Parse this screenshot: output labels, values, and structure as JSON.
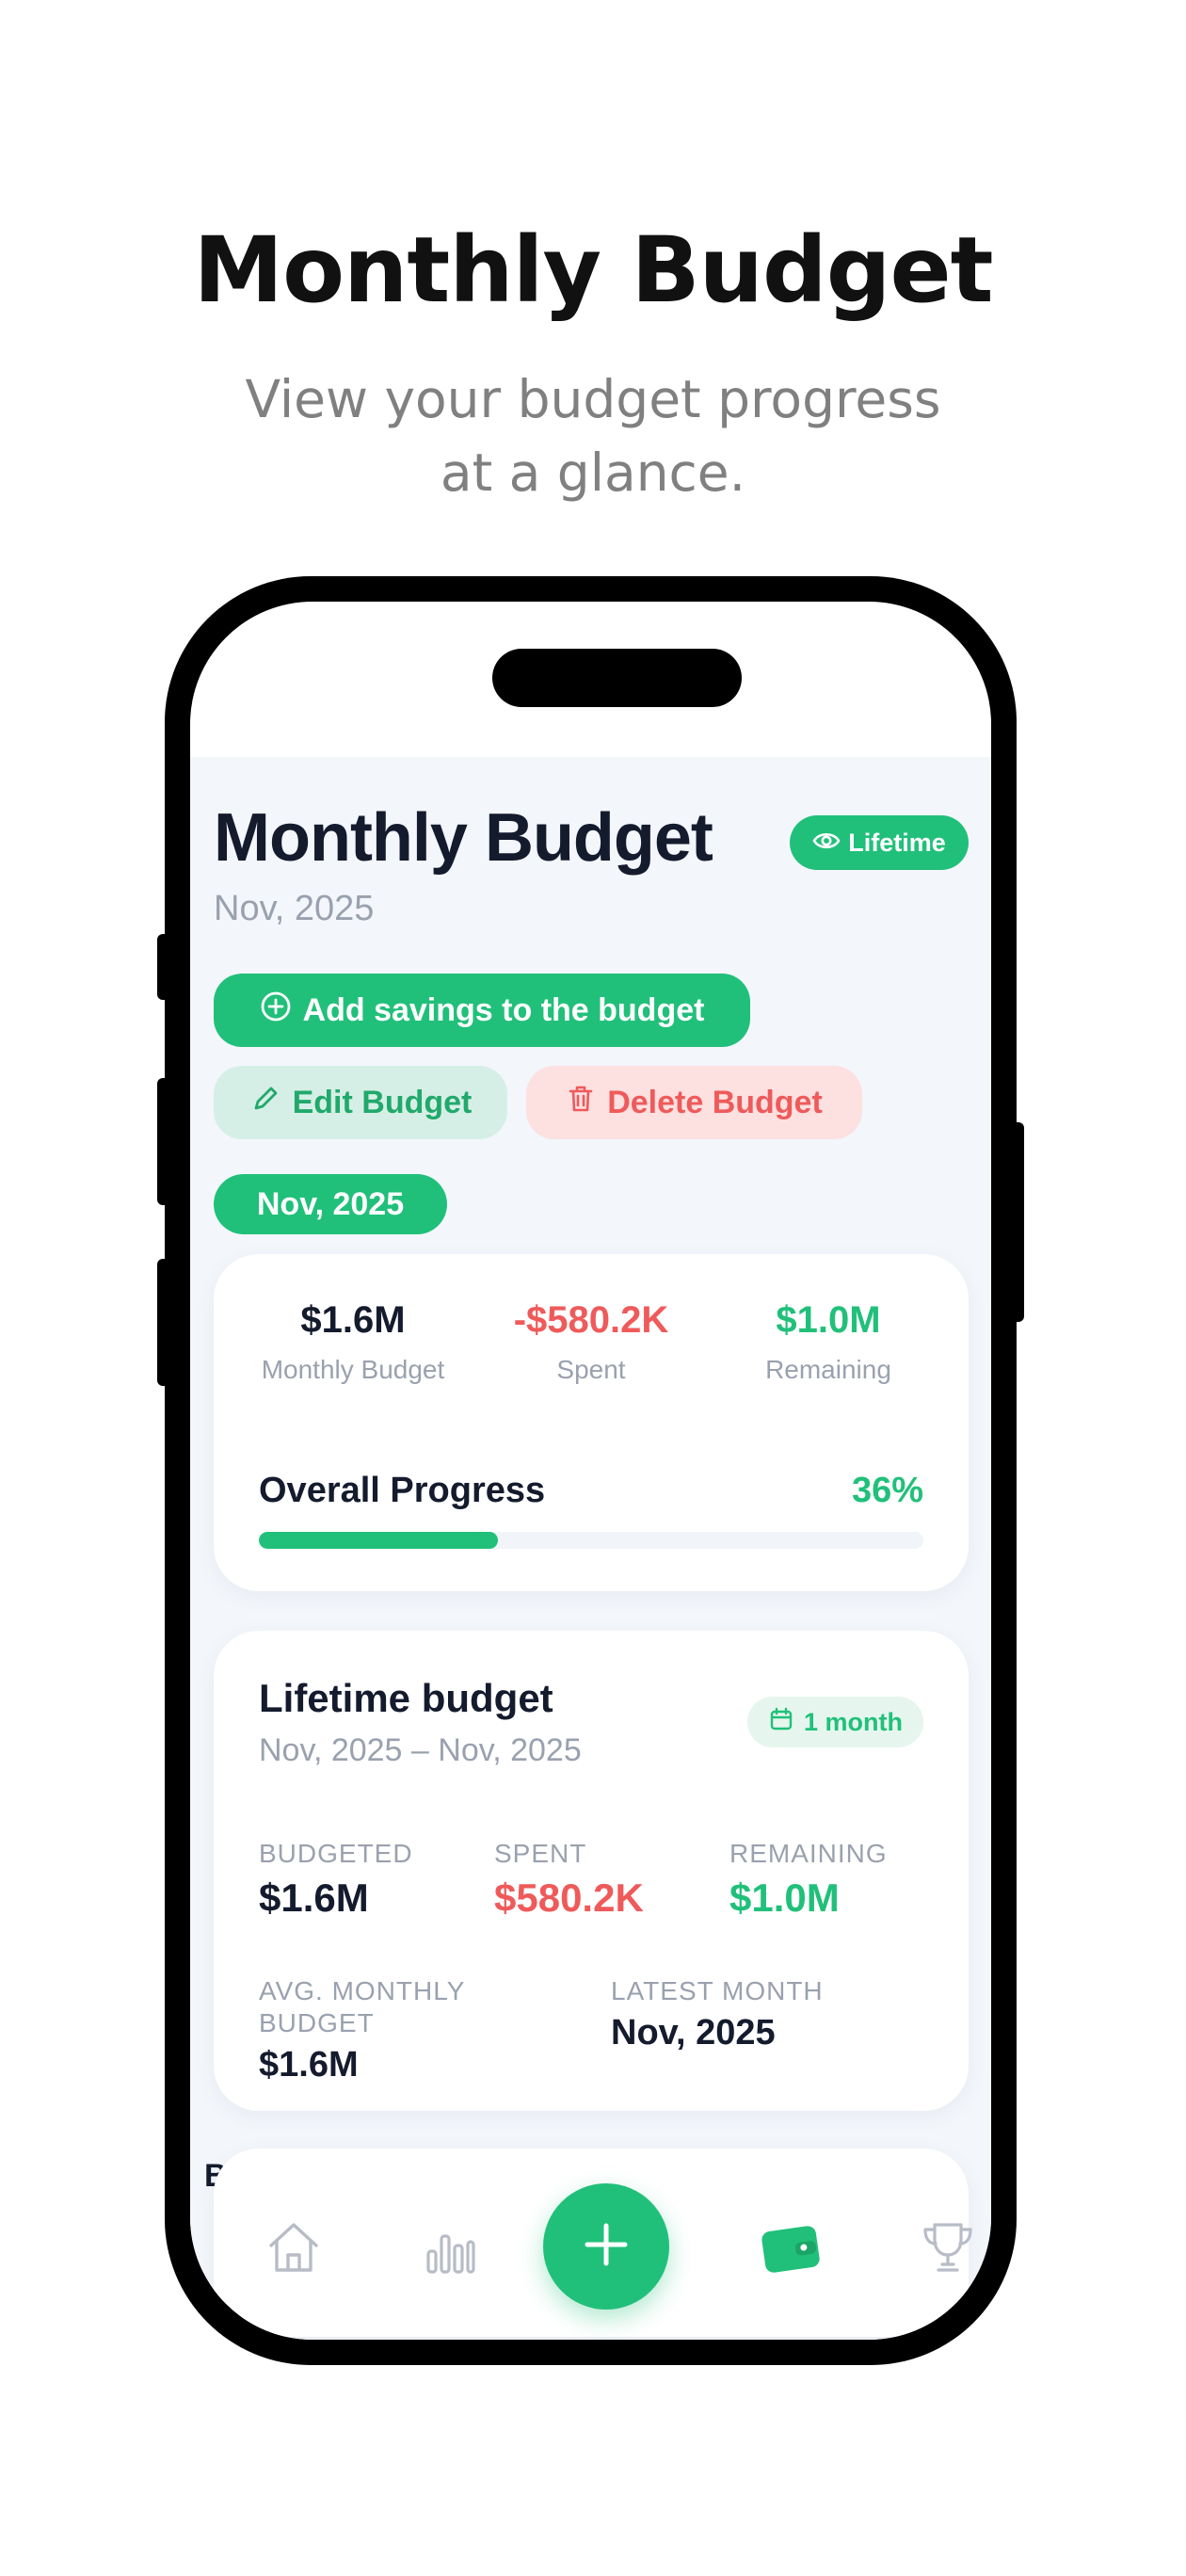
{
  "promo": {
    "title": "Monthly Budget",
    "subtitle": "View your budget progress at a glance."
  },
  "header": {
    "title": "Monthly Budget",
    "date": "Nov, 2025",
    "lifetime_label": "Lifetime"
  },
  "actions": {
    "add_savings": "Add savings to the budget",
    "edit": "Edit Budget",
    "delete": "Delete Budget"
  },
  "month_chip": "Nov, 2025",
  "summary": {
    "budget_value": "$1.6M",
    "budget_label": "Monthly Budget",
    "spent_value": "-$580.2K",
    "spent_label": "Spent",
    "remaining_value": "$1.0M",
    "remaining_label": "Remaining",
    "progress_label": "Overall Progress",
    "progress_text": "36%",
    "progress_fraction": 0.36
  },
  "lifetime": {
    "title": "Lifetime budget",
    "range": "Nov, 2025 – Nov, 2025",
    "duration": "1 month",
    "budgeted_label": "BUDGETED",
    "budgeted_value": "$1.6M",
    "spent_label": "SPENT",
    "spent_value": "$580.2K",
    "remaining_label": "REMAINING",
    "remaining_value": "$1.0M",
    "avg_label": "AVG. MONTHLY BUDGET",
    "avg_value": "$1.6M",
    "latest_label": "LATEST MONTH",
    "latest_value": "Nov, 2025"
  },
  "partial_text": "B",
  "colors": {
    "accent": "#21c07a",
    "danger": "#ef5a5a",
    "text": "#141b2d",
    "muted": "#9aa1ae"
  },
  "tabbar": {
    "icons": [
      "home-icon",
      "chart-icon",
      "plus-icon",
      "wallet-icon",
      "trophy-icon"
    ],
    "active": "wallet-icon"
  }
}
